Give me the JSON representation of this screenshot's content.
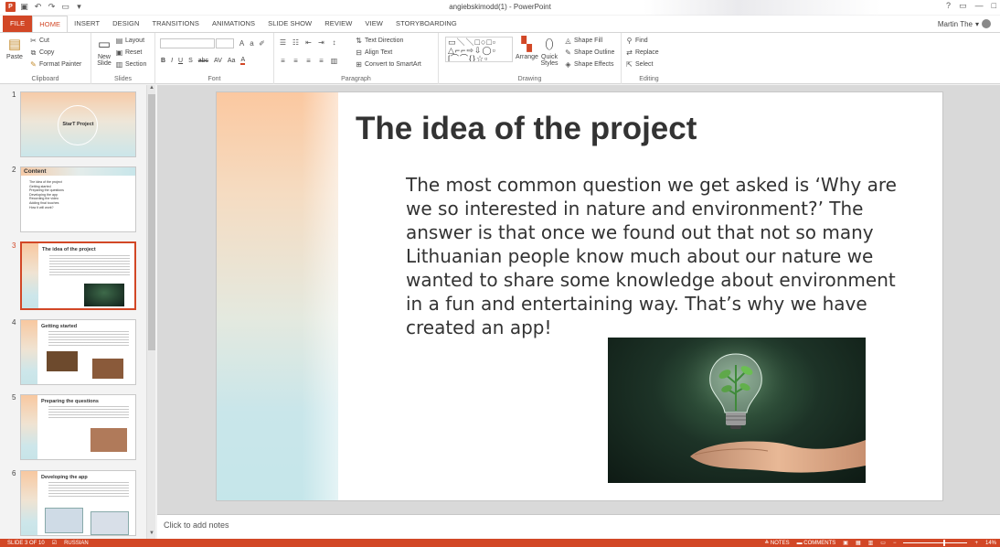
{
  "window": {
    "title": "angiebskimodd(1) - PowerPoint",
    "controls": [
      "?",
      "▭",
      "—",
      "□"
    ]
  },
  "tabs": [
    {
      "label": "FILE"
    },
    {
      "label": "HOME",
      "active": true
    },
    {
      "label": "INSERT"
    },
    {
      "label": "DESIGN"
    },
    {
      "label": "TRANSITIONS"
    },
    {
      "label": "ANIMATIONS"
    },
    {
      "label": "SLIDE SHOW"
    },
    {
      "label": "REVIEW"
    },
    {
      "label": "VIEW"
    },
    {
      "label": "STORYBOARDING"
    }
  ],
  "user": {
    "name": "Martin The"
  },
  "ribbon": {
    "clipboard": {
      "paste": "Paste",
      "cut": "Cut",
      "copy": "Copy",
      "format_painter": "Format Painter",
      "label": "Clipboard"
    },
    "slides": {
      "new_slide": "New Slide",
      "layout": "Layout",
      "reset": "Reset",
      "section": "Section",
      "label": "Slides"
    },
    "font": {
      "label": "Font",
      "letters": [
        "B",
        "I",
        "U",
        "S",
        "abc",
        "AV",
        "Aa",
        "A"
      ]
    },
    "paragraph": {
      "text_direction": "Text Direction",
      "align_text": "Align Text",
      "convert_smartart": "Convert to SmartArt",
      "label": "Paragraph"
    },
    "drawing": {
      "arrange": "Arrange",
      "quick_styles": "Quick Styles",
      "shape_fill": "Shape Fill",
      "shape_outline": "Shape Outline",
      "shape_effects": "Shape Effects",
      "label": "Drawing"
    },
    "editing": {
      "find": "Find",
      "replace": "Replace",
      "select": "Select",
      "label": "Editing"
    }
  },
  "thumbnails": [
    {
      "num": "1",
      "title": "StarT Project"
    },
    {
      "num": "2",
      "title": "Content",
      "items": [
        "The idea of the project",
        "Getting started",
        "Preparing the questions",
        "Developing the app",
        "Recording the video",
        "Adding final touches",
        "How it will work?"
      ]
    },
    {
      "num": "3",
      "title": "The idea of the project",
      "selected": true
    },
    {
      "num": "4",
      "title": "Getting started"
    },
    {
      "num": "5",
      "title": "Preparing the questions"
    },
    {
      "num": "6",
      "title": "Developing the app"
    }
  ],
  "slide": {
    "title": "The idea of the project",
    "body": "The most common question we get asked is ‘Why are we so interested in nature and environment?’ The answer is that once we found out that not so many Lithuanian people know much about our nature we wanted to share some knowledge about environment in a fun and entertaining way. That’s why we have created an app!"
  },
  "notes": {
    "placeholder": "Click to add notes"
  },
  "status": {
    "slide_info": "SLIDE 3 OF 10",
    "language": "RUSSIAN",
    "notes": "NOTES",
    "comments": "COMMENTS",
    "zoom": "14%"
  },
  "colors": {
    "accent": "#d24726"
  }
}
